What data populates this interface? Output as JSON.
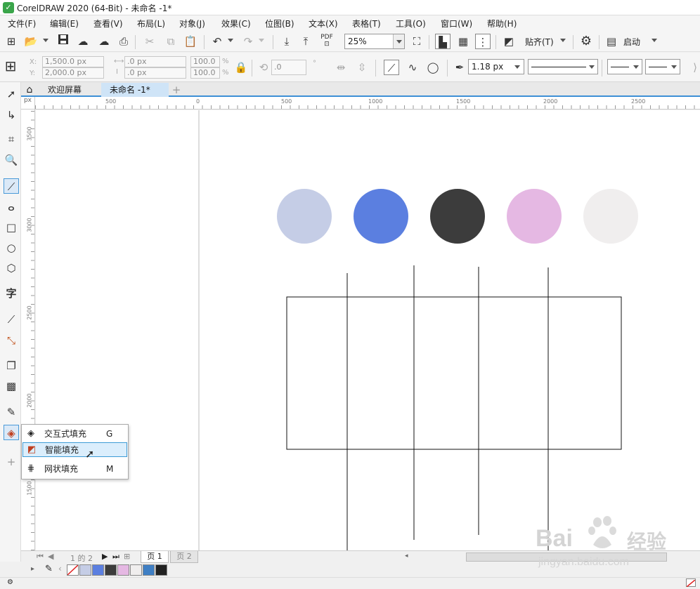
{
  "window": {
    "title": "CorelDRAW 2020 (64-Bit) - 未命名 -1*"
  },
  "menu": [
    "文件(F)",
    "编辑(E)",
    "查看(V)",
    "布局(L)",
    "对象(J)",
    "效果(C)",
    "位图(B)",
    "文本(X)",
    "表格(T)",
    "工具(O)",
    "窗口(W)",
    "帮助(H)"
  ],
  "toolbar": {
    "zoom_value": "25%",
    "snap_label": "贴齐(T)",
    "launch_label": "启动",
    "pdf_label": "PDF"
  },
  "property_bar": {
    "x_label": "X:",
    "y_label": "Y:",
    "x_value": "1,500.0 px",
    "y_value": "2,000.0 px",
    "w_value": ".0 px",
    "h_value": ".0 px",
    "scale_w": "100.0",
    "scale_h": "100.0",
    "percent": "%",
    "angle_value": ".0",
    "degree": "°",
    "outline_width": "1.18 px"
  },
  "tabs": [
    {
      "label": "欢迎屏幕"
    },
    {
      "label": "未命名 -1*"
    }
  ],
  "rulers": {
    "horizontal": [
      "500",
      "0",
      "500",
      "1000",
      "1500",
      "2000",
      "2500"
    ],
    "vertical": [
      "3500",
      "3000",
      "2500",
      "2000",
      "1500"
    ],
    "corner": "px"
  },
  "canvas": {
    "circle_colors": [
      "#c5cde6",
      "#5b7fe0",
      "#3c3c3c",
      "#e5b8e3",
      "#f0eeee"
    ]
  },
  "flyout": {
    "items": [
      {
        "icon": "interactive-fill-icon",
        "label": "交互式填充",
        "key": "G"
      },
      {
        "icon": "smart-fill-icon",
        "label": "智能填充",
        "key": ""
      },
      {
        "icon": "mesh-fill-icon",
        "label": "网状填充",
        "key": "M"
      }
    ]
  },
  "pagebar": {
    "page_info": "1 的 2",
    "page1": "页 1",
    "page2": "页 2"
  },
  "palette": {
    "colors": [
      "#c5cde6",
      "#5b7fe0",
      "#3c3c3c",
      "#e5b8e3",
      "#f0eeee",
      "#3f7fc4",
      "#222222"
    ]
  },
  "watermark": {
    "brand": "Bai",
    "brand2": "经验",
    "url": "jingyan.baidu.com"
  }
}
